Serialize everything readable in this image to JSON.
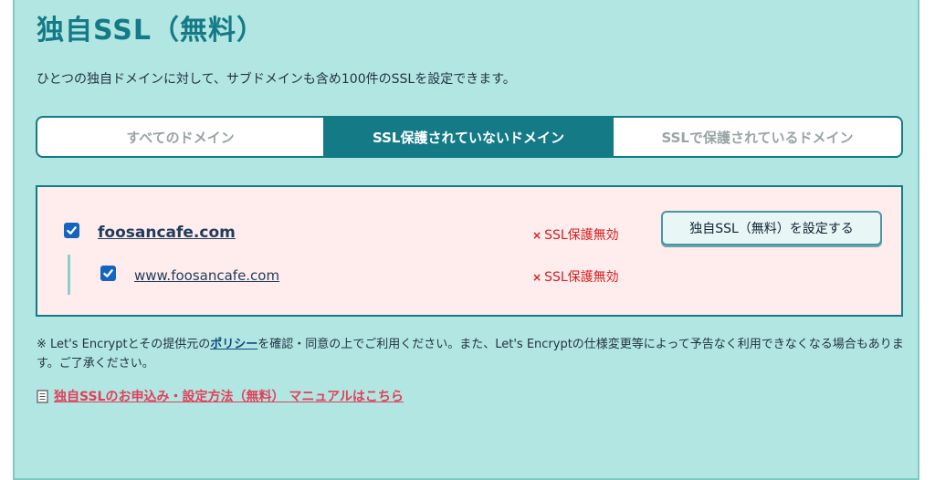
{
  "page": {
    "title": "独自SSL（無料）",
    "description": "ひとつの独自ドメインに対して、サブドメインも含め100件のSSLを設定できます。"
  },
  "tabs": [
    {
      "label": "すべてのドメイン",
      "active": false
    },
    {
      "label": "SSL保護されていないドメイン",
      "active": true
    },
    {
      "label": "SSLで保護されているドメイン",
      "active": false
    }
  ],
  "domains": {
    "primary": {
      "name": "foosancafe.com",
      "checked": true,
      "status": "SSL保護無効",
      "status_mark": "×"
    },
    "sub": {
      "name": "www.foosancafe.com",
      "checked": true,
      "status": "SSL保護無効",
      "status_mark": "×"
    },
    "action_label": "独自SSL（無料）を設定する"
  },
  "notice": {
    "prefix": "※ Let's Encryptとその提供元の",
    "link": "ポリシー",
    "suffix": "を確認・同意の上でご利用ください。また、Let's Encryptの仕様変更等によって予告なく利用できなくなる場合もあります。ご了承ください。"
  },
  "manual": {
    "icon": "document-icon",
    "label": "独自SSLのお申込み・設定方法（無料） マニュアルはこちら"
  },
  "colors": {
    "panel_bg": "#b2e6e2",
    "accent": "#137a86",
    "error": "#d42020",
    "link_pink": "#e0405a",
    "checkbox": "#1565c0"
  }
}
